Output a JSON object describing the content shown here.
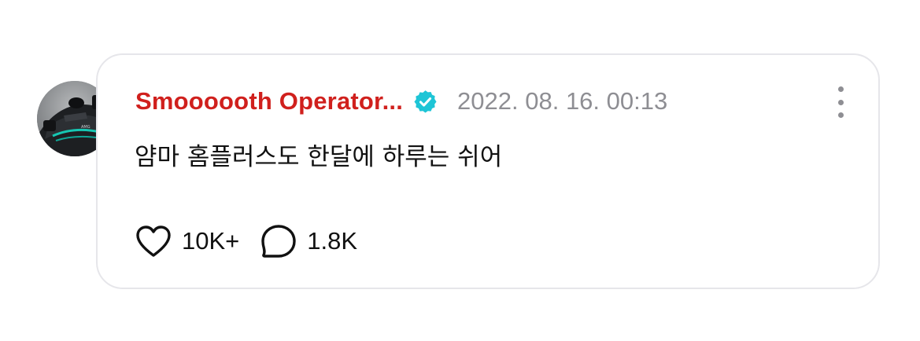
{
  "comment": {
    "author": "Smoooooth Operator...",
    "verified_icon": "verified-badge-icon",
    "timestamp": "2022. 08. 16. 00:13",
    "text": "얌마 홈플러스도 한달에 하루는 쉬어",
    "likes": "10K+",
    "replies": "1.8K"
  },
  "colors": {
    "author": "#d0201d",
    "verified": "#1ec5d6",
    "timestamp": "#8e8e93",
    "card_border": "#e6e6ea"
  },
  "icons": {
    "like": "heart-outline-icon",
    "reply": "speech-bubble-icon",
    "more": "more-vertical-icon"
  }
}
